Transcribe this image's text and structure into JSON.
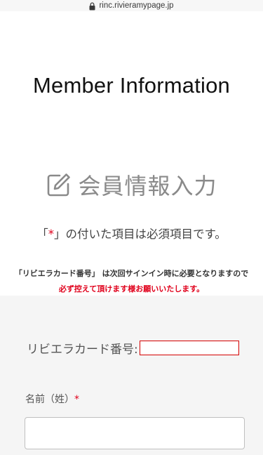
{
  "browser": {
    "url": "rinc.rivieramypage.jp"
  },
  "header": {
    "title": "Member Information"
  },
  "section": {
    "heading": "会員情報入力",
    "icon": "edit-icon"
  },
  "required_note": {
    "prefix": "「",
    "star": "*",
    "suffix": "」の付いた項目は必須項目です。"
  },
  "notice": {
    "line1": "「リビエラカード番号」 は次回サインイン時に必要となりますので",
    "line2": "必ず控えて頂けます様お願いいたします。"
  },
  "form": {
    "card_label": "リビエラカード番号:",
    "card_value": "",
    "name_label": "名前（姓）",
    "name_required": "*",
    "name_value": ""
  },
  "colors": {
    "required": "#e0001b",
    "background": "#ffffff",
    "form_background": "#f5f5f5"
  }
}
